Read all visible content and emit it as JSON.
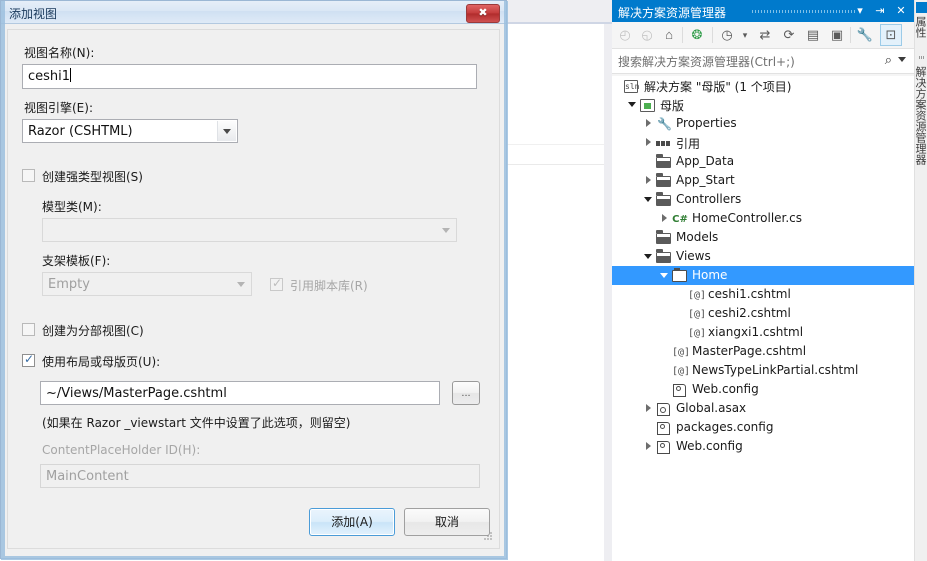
{
  "background": {
    "name": "visual-studio-editor"
  },
  "dialog": {
    "title": "添加视图",
    "close_glyph": "✖",
    "view_name_label": "视图名称(N):",
    "view_name_value": "ceshi1",
    "view_engine_label": "视图引擎(E):",
    "view_engine_value": "Razor (CSHTML)",
    "strongly_typed_label": "创建强类型视图(S)",
    "model_class_label": "模型类(M):",
    "model_class_value": "",
    "scaffold_template_label": "支架模板(F):",
    "scaffold_template_value": "Empty",
    "reference_script_label": "引用脚本库(R)",
    "partial_view_label": "创建为分部视图(C)",
    "use_layout_label": "使用布局或母版页(U):",
    "layout_path_value": "~/Views/MasterPage.cshtml",
    "browse_label": "...",
    "layout_hint": "(如果在 Razor _viewstart 文件中设置了此选项，则留空)",
    "contentplaceholder_label": "ContentPlaceHolder ID(H):",
    "contentplaceholder_value": "MainContent",
    "add_button": "添加(A)",
    "cancel_button": "取消",
    "accent_color": "#007acc",
    "titlebar_color": "#dae7f5",
    "close_color": "#c23a3a"
  },
  "solution_explorer": {
    "title": "解决方案资源管理器",
    "title_buttons": [
      "▾",
      "⇥",
      "✕"
    ],
    "search_placeholder": "搜索解决方案资源管理器(Ctrl+;)",
    "search_icon": "⌕",
    "toolbar": [
      {
        "name": "back",
        "glyph": "◴",
        "disabled": true
      },
      {
        "name": "forward",
        "glyph": "◵",
        "disabled": true
      },
      {
        "name": "home",
        "glyph": "⌂",
        "disabled": false
      },
      {
        "name": "show-all-files",
        "glyph": "❂",
        "disabled": false
      },
      {
        "name": "pending-changes",
        "glyph": "◷",
        "disabled": false
      },
      {
        "name": "pending-changes-dropdown",
        "glyph": "▾",
        "disabled": false
      },
      {
        "name": "sync-with-active-document",
        "glyph": "⇄",
        "disabled": false
      },
      {
        "name": "refresh",
        "glyph": "⟳",
        "disabled": false
      },
      {
        "name": "collapse-all",
        "glyph": "▤",
        "disabled": false
      },
      {
        "name": "view-code",
        "glyph": "▣",
        "disabled": false
      },
      {
        "name": "properties",
        "glyph": "🔧",
        "disabled": false
      },
      {
        "name": "preview-selected-items",
        "glyph": "⊡",
        "disabled": false,
        "selected": true
      }
    ],
    "tree": [
      {
        "label": "解决方案 \"母版\" (1 个项目)",
        "indent": 0,
        "icon": "solution",
        "twisty": "none",
        "selected": false
      },
      {
        "label": "母版",
        "indent": 1,
        "icon": "project",
        "twisty": "open",
        "selected": false
      },
      {
        "label": "Properties",
        "indent": 2,
        "icon": "wrench",
        "twisty": "closed",
        "selected": false
      },
      {
        "label": "引用",
        "indent": 2,
        "icon": "reference",
        "twisty": "closed",
        "selected": false
      },
      {
        "label": "App_Data",
        "indent": 2,
        "icon": "folder",
        "twisty": "none",
        "selected": false
      },
      {
        "label": "App_Start",
        "indent": 2,
        "icon": "folder",
        "twisty": "closed",
        "selected": false
      },
      {
        "label": "Controllers",
        "indent": 2,
        "icon": "folder",
        "twisty": "open",
        "selected": false
      },
      {
        "label": "HomeController.cs",
        "indent": 3,
        "icon": "csharp",
        "twisty": "closed",
        "selected": false
      },
      {
        "label": "Models",
        "indent": 2,
        "icon": "folder",
        "twisty": "none",
        "selected": false
      },
      {
        "label": "Views",
        "indent": 2,
        "icon": "folder",
        "twisty": "open",
        "selected": false
      },
      {
        "label": "Home",
        "indent": 3,
        "icon": "folder-open",
        "twisty": "open",
        "selected": true
      },
      {
        "label": "ceshi1.cshtml",
        "indent": 4,
        "icon": "razor",
        "twisty": "none",
        "selected": false
      },
      {
        "label": "ceshi2.cshtml",
        "indent": 4,
        "icon": "razor",
        "twisty": "none",
        "selected": false
      },
      {
        "label": "xiangxi1.cshtml",
        "indent": 4,
        "icon": "razor",
        "twisty": "none",
        "selected": false
      },
      {
        "label": "MasterPage.cshtml",
        "indent": 3,
        "icon": "razor",
        "twisty": "none",
        "selected": false
      },
      {
        "label": "NewsTypeLinkPartial.cshtml",
        "indent": 3,
        "icon": "razor",
        "twisty": "none",
        "selected": false
      },
      {
        "label": "Web.config",
        "indent": 3,
        "icon": "config",
        "twisty": "none",
        "selected": false
      },
      {
        "label": "Global.asax",
        "indent": 2,
        "icon": "asax",
        "twisty": "closed",
        "selected": false
      },
      {
        "label": "packages.config",
        "indent": 2,
        "icon": "config",
        "twisty": "none",
        "selected": false
      },
      {
        "label": "Web.config",
        "indent": 2,
        "icon": "config",
        "twisty": "closed",
        "selected": false
      }
    ],
    "vertical_tabs": [
      {
        "label": "属性",
        "active": true
      },
      {
        "label": "解决方案资源管理器",
        "active": false
      }
    ]
  }
}
